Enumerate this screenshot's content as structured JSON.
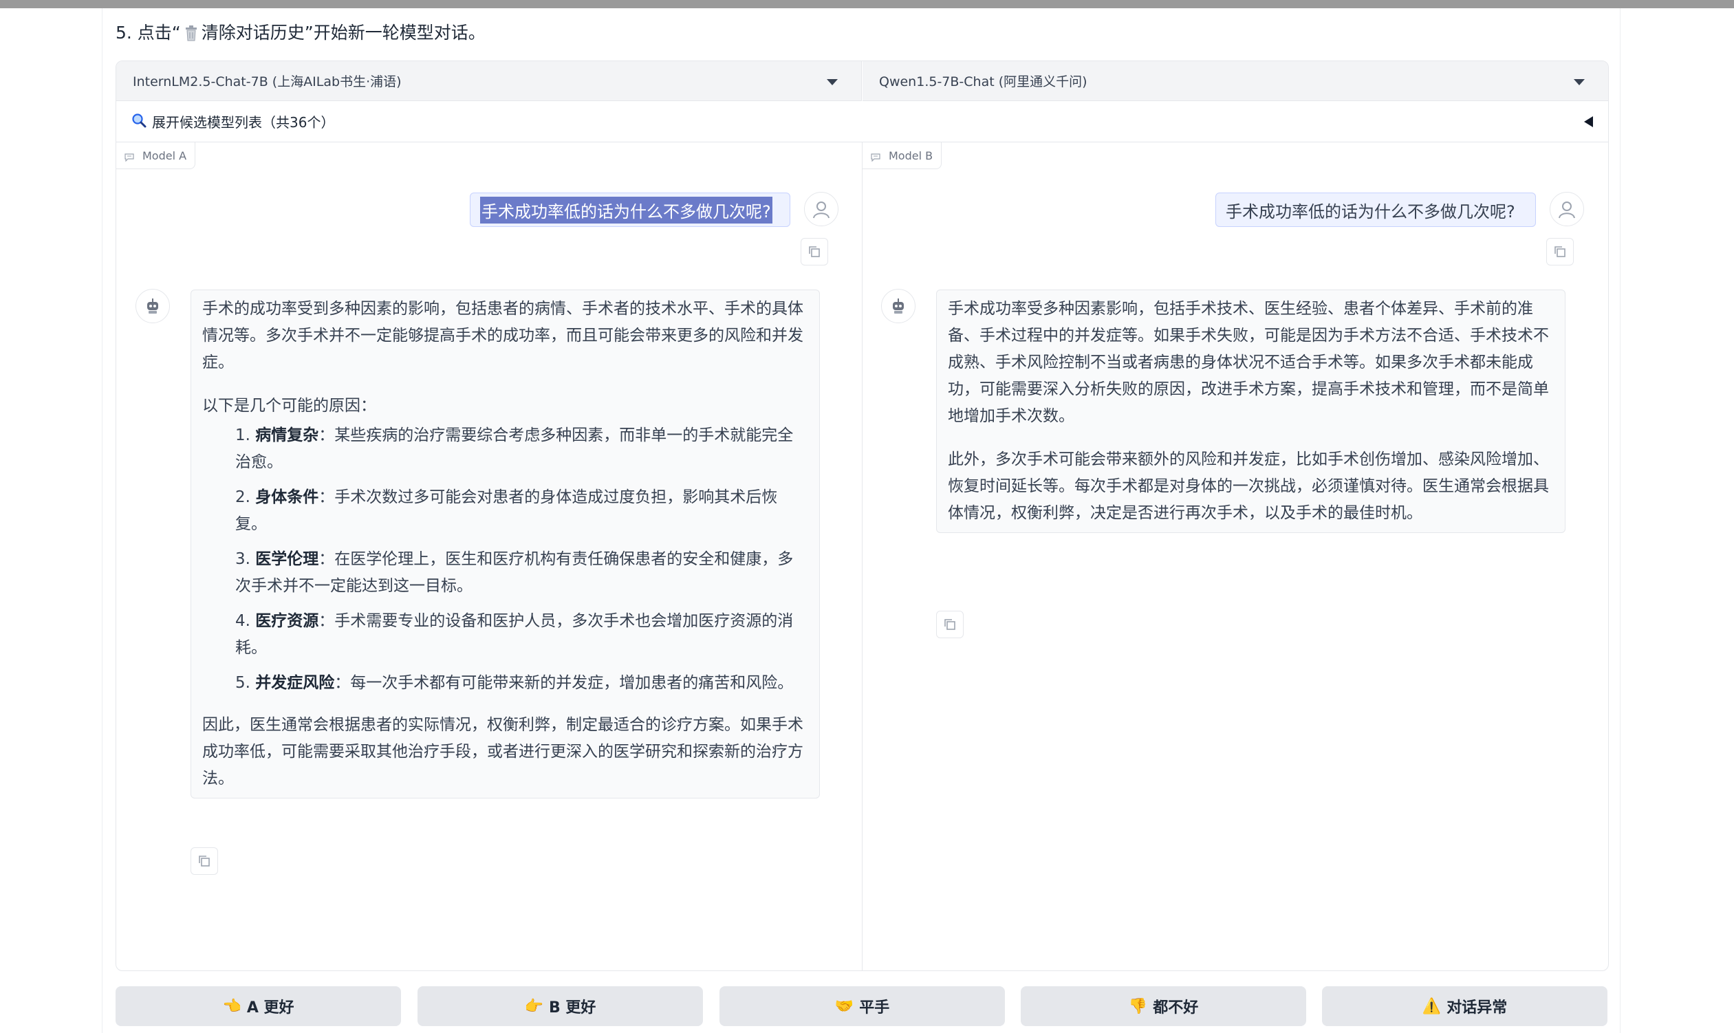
{
  "instruction": {
    "prefix": "5. 点击“",
    "action": "清除对话历史",
    "suffix": "”开始新一轮模型对话。",
    "icon": "trash-icon"
  },
  "selectors": {
    "model_a": "InternLM2.5-Chat-7B (上海AILab书生·浦语)",
    "model_b": "Qwen1.5-7B-Chat (阿里通义千问)"
  },
  "expander": {
    "label": "展开候选模型列表（共36个）",
    "icon": "magnifier-icon"
  },
  "chat_a": {
    "tag": "Model A",
    "user_message": "手术成功率低的话为什么不多做几次呢?",
    "response": {
      "intro": "手术的成功率受到多种因素的影响，包括患者的病情、手术者的技术水平、手术的具体情况等。多次手术并不一定能够提高手术的成功率，而且可能会带来更多的风险和并发症。",
      "lead": "以下是几个可能的原因：",
      "items": [
        {
          "num": "1.",
          "title": "病情复杂",
          "text": "：某些疾病的治疗需要综合考虑多种因素，而非单一的手术就能完全治愈。"
        },
        {
          "num": "2.",
          "title": "身体条件",
          "text": "：手术次数过多可能会对患者的身体造成过度负担，影响其术后恢复。"
        },
        {
          "num": "3.",
          "title": "医学伦理",
          "text": "：在医学伦理上，医生和医疗机构有责任确保患者的安全和健康，多次手术并不一定能达到这一目标。"
        },
        {
          "num": "4.",
          "title": "医疗资源",
          "text": "：手术需要专业的设备和医护人员，多次手术也会增加医疗资源的消耗。"
        },
        {
          "num": "5.",
          "title": "并发症风险",
          "text": "：每一次手术都有可能带来新的并发症，增加患者的痛苦和风险。"
        }
      ],
      "conclusion": "因此，医生通常会根据患者的实际情况，权衡利弊，制定最适合的诊疗方案。如果手术成功率低，可能需要采取其他治疗手段，或者进行更深入的医学研究和探索新的治疗方法。"
    }
  },
  "chat_b": {
    "tag": "Model B",
    "user_message": "手术成功率低的话为什么不多做几次呢?",
    "response": {
      "p1": "手术成功率受多种因素影响，包括手术技术、医生经验、患者个体差异、手术前的准备、手术过程中的并发症等。如果手术失败，可能是因为手术方法不合适、手术技术不成熟、手术风险控制不当或者病患的身体状况不适合手术等。如果多次手术都未能成功，可能需要深入分析失败的原因，改进手术方案，提高手术技术和管理，而不是简单地增加手术次数。",
      "p2": "此外，多次手术可能会带来额外的风险和并发症，比如手术创伤增加、感染风险增加、恢复时间延长等。每次手术都是对身体的一次挑战，必须谨慎对待。医生通常会根据具体情况，权衡利弊，决定是否进行再次手术，以及手术的最佳时机。"
    }
  },
  "vote_buttons": [
    {
      "emoji": "👈",
      "label": "A 更好"
    },
    {
      "emoji": "👉",
      "label": "B 更好"
    },
    {
      "emoji": "🤝",
      "label": "平手"
    },
    {
      "emoji": "👎",
      "label": "都不好"
    },
    {
      "emoji": "⚠️",
      "label": "对话异常"
    }
  ]
}
